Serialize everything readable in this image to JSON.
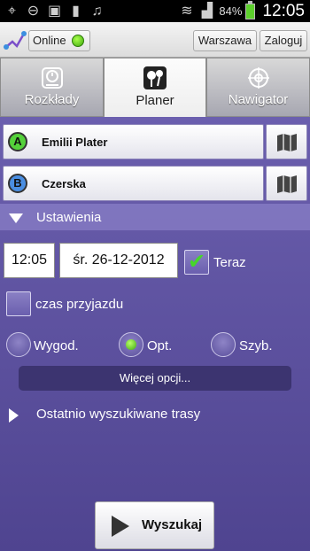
{
  "status_bar": {
    "battery_pct": "84%",
    "time": "12:05",
    "icons": [
      "gps-icon",
      "minus-circle-icon",
      "image-icon",
      "signal-bars-icon",
      "bell-icon",
      "wifi-icon",
      "cell-signal-icon",
      "battery-icon"
    ]
  },
  "header": {
    "online_label": "Online",
    "city_label": "Warszawa",
    "login_label": "Zaloguj",
    "online_color": "#54d13a"
  },
  "tabs": [
    {
      "label": "Rozkłady",
      "icon": "schedule-icon",
      "active": false
    },
    {
      "label": "Planer",
      "icon": "map-pins-icon",
      "active": true
    },
    {
      "label": "Nawigator",
      "icon": "compass-icon",
      "active": false
    }
  ],
  "route": {
    "from": {
      "badge": "A",
      "name": "Emilii Plater"
    },
    "to": {
      "badge": "B",
      "name": "Czerska"
    }
  },
  "settings": {
    "header": "Ustawienia",
    "time": "12:05",
    "date": "śr. 26-12-2012",
    "now_label": "Teraz",
    "now_checked": true,
    "arrival_label": "czas przyjazdu",
    "arrival_checked": false,
    "options": [
      {
        "label": "Wygod.",
        "selected": false
      },
      {
        "label": "Opt.",
        "selected": true
      },
      {
        "label": "Szyb.",
        "selected": false
      }
    ],
    "more_label": "Więcej opcji..."
  },
  "recent": {
    "header": "Ostatnio wyszukiwane trasy"
  },
  "search_label": "Wyszukaj",
  "colors": {
    "background": "#5c4e99",
    "accent_green": "#54d13a",
    "badge_b": "#4a8ee2"
  }
}
